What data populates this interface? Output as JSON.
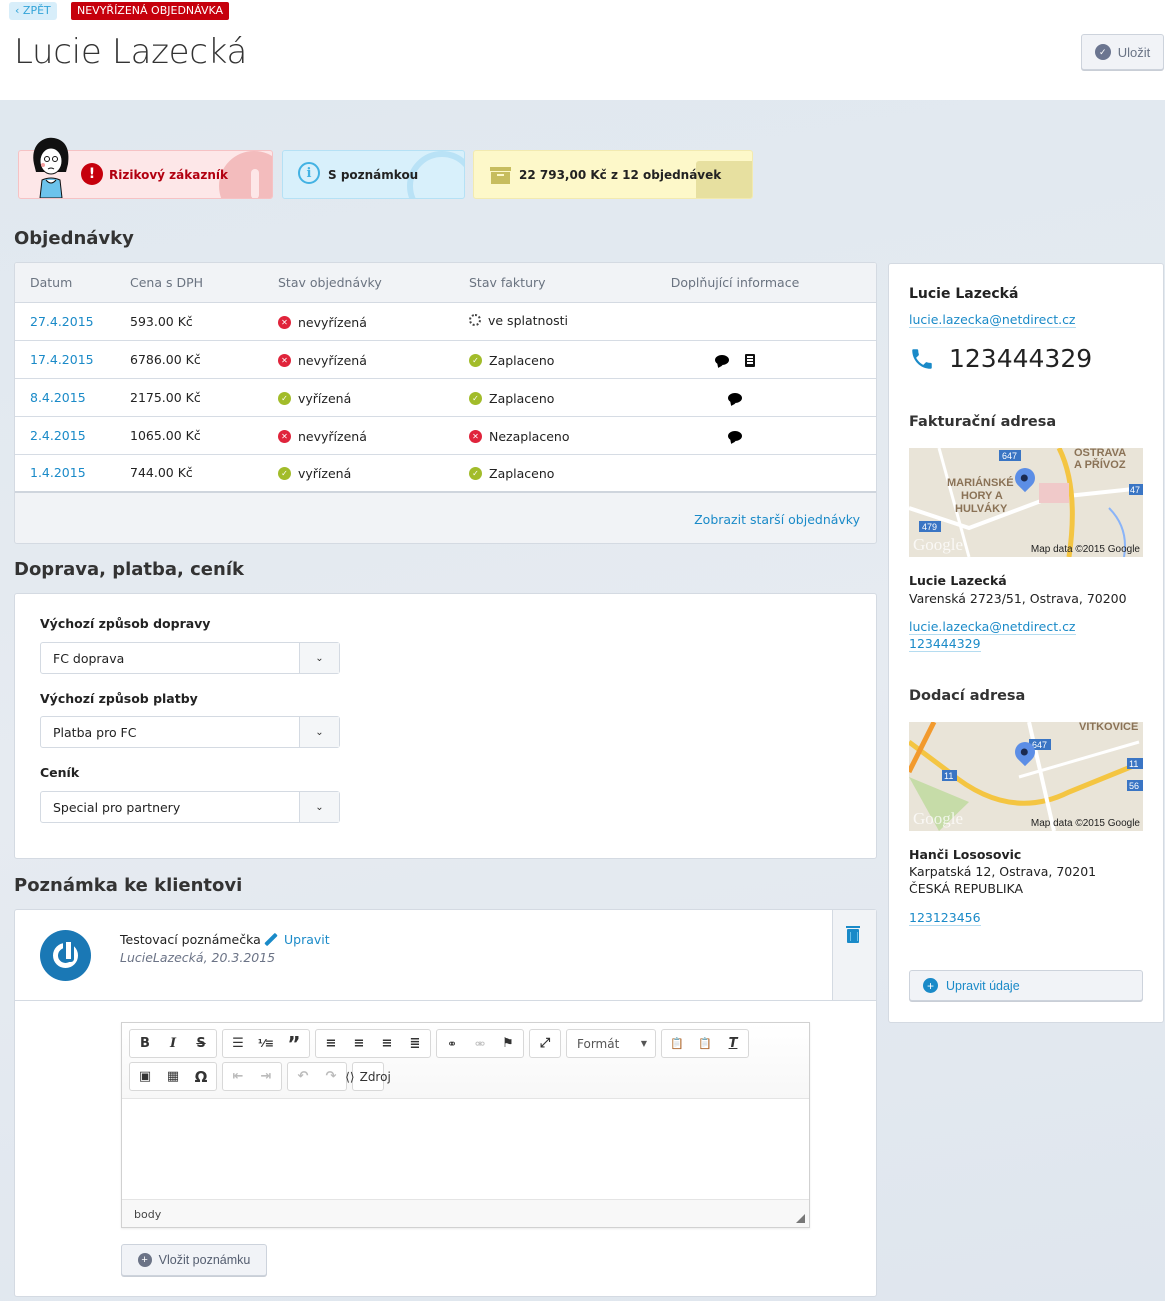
{
  "header": {
    "back_label": "ZPĚT",
    "status_badge": "NEVYŘÍZENÁ OBJEDNÁVKA",
    "title": "Lucie Lazecká",
    "save_label": "Uložit"
  },
  "tiles": {
    "risk": "Rizikový zákazník",
    "note": "S poznámkou",
    "spend": "22 793,00 Kč z 12 objednávek"
  },
  "orders": {
    "heading": "Objednávky",
    "columns": [
      "Datum",
      "Cena s DPH",
      "Stav objednávky",
      "Stav faktury",
      "Doplňující informace"
    ],
    "rows": [
      {
        "date": "27.4.2015",
        "price": "593.00 Kč",
        "order_status": "nevyřízená",
        "order_state": "error",
        "invoice_status": "ve splatnosti",
        "invoice_state": "pending",
        "extras": []
      },
      {
        "date": "17.4.2015",
        "price": "6786.00 Kč",
        "order_status": "nevyřízená",
        "order_state": "error",
        "invoice_status": "Zaplaceno",
        "invoice_state": "ok",
        "extras": [
          "comment-icon",
          "clipboard-icon"
        ]
      },
      {
        "date": "8.4.2015",
        "price": "2175.00 Kč",
        "order_status": "vyřízená",
        "order_state": "ok",
        "invoice_status": "Zaplaceno",
        "invoice_state": "ok",
        "extras": [
          "comment-icon"
        ]
      },
      {
        "date": "2.4.2015",
        "price": "1065.00 Kč",
        "order_status": "nevyřízená",
        "order_state": "error",
        "invoice_status": "Nezaplaceno",
        "invoice_state": "error",
        "extras": [
          "comment-icon"
        ]
      },
      {
        "date": "1.4.2015",
        "price": "744.00 Kč",
        "order_status": "vyřízená",
        "order_state": "ok",
        "invoice_status": "Zaplaceno",
        "invoice_state": "ok",
        "extras": []
      }
    ],
    "older_link": "Zobrazit starší objednávky"
  },
  "shipping": {
    "heading": "Doprava, platba, ceník",
    "fields": [
      {
        "label": "Výchozí způsob dopravy",
        "value": "FC doprava"
      },
      {
        "label": "Výchozí způsob platby",
        "value": "Platba pro FC"
      },
      {
        "label": "Ceník",
        "value": "Special pro partnery"
      }
    ]
  },
  "note": {
    "heading": "Poznámka ke klientovi",
    "text": "Testovací poznámečka",
    "edit_label": "Upravit",
    "meta": "LucieLazecká, 20.3.2015",
    "editor": {
      "format_label": "Formát",
      "source_label": "Zdroj",
      "path": "body"
    },
    "add_label": "Vložit poznámku"
  },
  "sidebar": {
    "name": "Lucie Lazecká",
    "email": "lucie.lazecka@netdirect.cz",
    "phone": "123444329",
    "billing": {
      "heading": "Fakturační adresa",
      "map_attribution": "Map data ©2015 Google",
      "map_logo": "Google",
      "name": "Lucie Lazecká",
      "address": "Varenská 2723/51, Ostrava, 70200",
      "email": "lucie.lazecka@netdirect.cz",
      "phone": "123444329"
    },
    "delivery": {
      "heading": "Dodací adresa",
      "map_attribution": "Map data ©2015 Google",
      "map_logo": "Google",
      "name": "Hanči Lososovic",
      "address": "Karpatská 12, Ostrava, 70201",
      "country": "ČESKÁ REPUBLIKA",
      "phone": "123123456"
    },
    "edit_label": "Upravit údaje"
  },
  "colors": {
    "accent": "#1a8ac8",
    "danger": "#c6000c",
    "success": "#a2bc2a"
  }
}
